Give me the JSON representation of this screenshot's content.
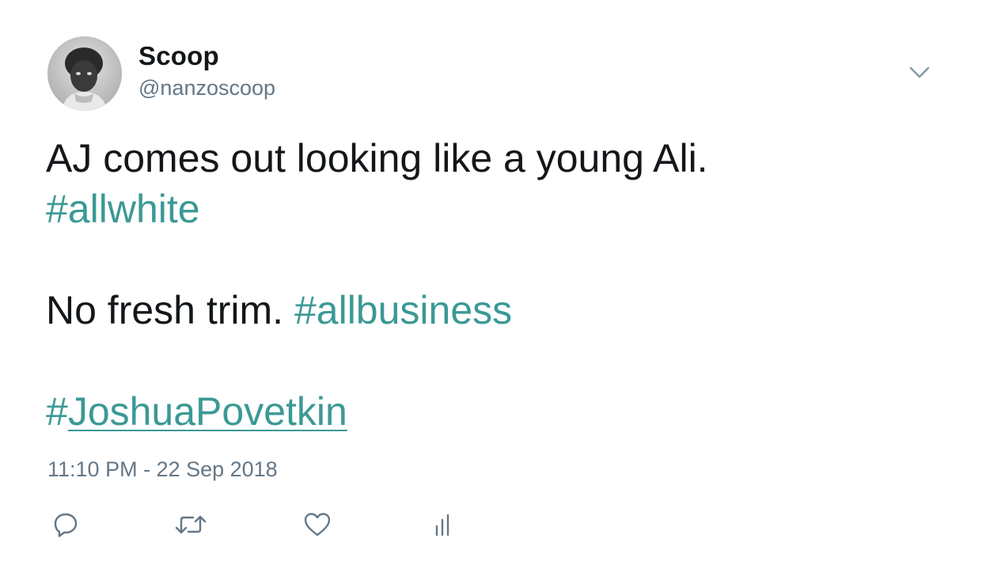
{
  "author": {
    "display_name": "Scoop",
    "handle": "@nanzoscoop",
    "avatar_icon": "avatar-photo"
  },
  "tweet": {
    "line1_text": "AJ comes out looking like a young Ali.",
    "hashtag1": "#allwhite",
    "line3_text": "No fresh trim.",
    "hashtag2": "#allbusiness",
    "hashtag3_hash": "#",
    "hashtag3_word": "JoshuaPovetkin",
    "timestamp": "11:10 PM - 22 Sep 2018"
  },
  "actions": [
    {
      "name": "reply",
      "icon": "reply-icon"
    },
    {
      "name": "retweet",
      "icon": "retweet-icon"
    },
    {
      "name": "like",
      "icon": "heart-icon"
    },
    {
      "name": "analytics",
      "icon": "analytics-icon"
    }
  ],
  "colors": {
    "text": "#14171a",
    "secondary": "#657786",
    "hashtag": "#3b9995",
    "icon": "#657786"
  }
}
